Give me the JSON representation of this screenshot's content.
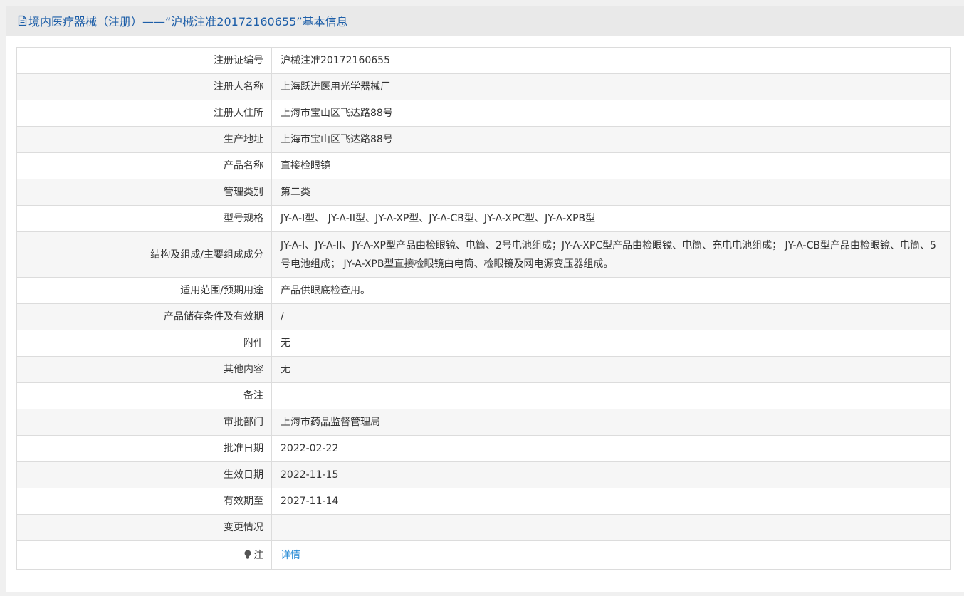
{
  "header": {
    "title": "境内医疗器械（注册）——“沪械注准20172160655”基本信息",
    "icon": "document-icon"
  },
  "rows": [
    {
      "label": "注册证编号",
      "value": "沪械注准20172160655"
    },
    {
      "label": "注册人名称",
      "value": "上海跃进医用光学器械厂"
    },
    {
      "label": "注册人住所",
      "value": "上海市宝山区飞达路88号"
    },
    {
      "label": "生产地址",
      "value": "上海市宝山区飞达路88号"
    },
    {
      "label": "产品名称",
      "value": "直接检眼镜"
    },
    {
      "label": "管理类别",
      "value": "第二类"
    },
    {
      "label": "型号规格",
      "value": "JY-A-I型、 JY-A-II型、JY-A-XP型、JY-A-CB型、JY-A-XPC型、JY-A-XPB型"
    },
    {
      "label": "结构及组成/主要组成成分",
      "value": "JY-A-I、JY-A-II、JY-A-XP型产品由检眼镜、电筒、2号电池组成；JY-A-XPC型产品由检眼镜、电筒、充电电池组成； JY-A-CB型产品由检眼镜、电筒、5号电池组成； JY-A-XPB型直接检眼镜由电筒、检眼镜及网电源变压器组成。"
    },
    {
      "label": "适用范围/预期用途",
      "value": "产品供眼底检查用。"
    },
    {
      "label": "产品储存条件及有效期",
      "value": "/"
    },
    {
      "label": "附件",
      "value": "无"
    },
    {
      "label": "其他内容",
      "value": "无"
    },
    {
      "label": "备注",
      "value": ""
    },
    {
      "label": "审批部门",
      "value": "上海市药品监督管理局"
    },
    {
      "label": "批准日期",
      "value": "2022-02-22"
    },
    {
      "label": "生效日期",
      "value": "2022-11-15"
    },
    {
      "label": "有效期至",
      "value": "2027-11-14"
    },
    {
      "label": "变更情况",
      "value": ""
    }
  ],
  "note": {
    "label": "注",
    "icon": "lightbulb-icon",
    "link_text": "详情"
  },
  "colors": {
    "title": "#1d5ea8",
    "link": "#2a8cd6",
    "border": "#dcdcdc",
    "stripe": "#f6f6f6"
  }
}
